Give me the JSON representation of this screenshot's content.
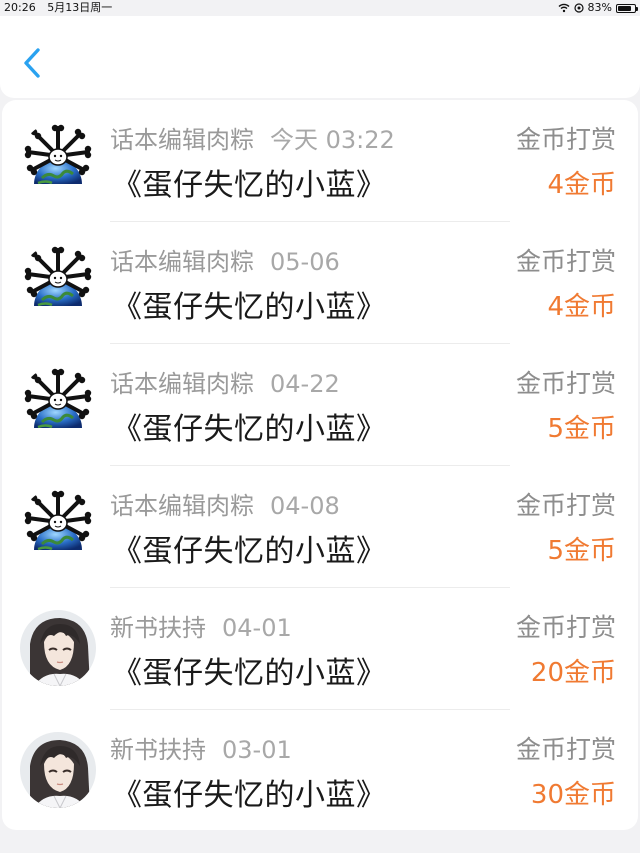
{
  "status_bar": {
    "time": "20:26",
    "date": "5月13日周一",
    "battery": "83%",
    "battery_level": 0.83
  },
  "nav": {
    "back_icon": "chevron-left-icon",
    "accent_color": "#2aa2f0"
  },
  "records": [
    {
      "user": "话本编辑肉粽",
      "date": "今天 03:22",
      "book": "《蛋仔失忆的小蓝》",
      "type": "金币打赏",
      "amount": "4金币",
      "avatar": "bones-globe"
    },
    {
      "user": "话本编辑肉粽",
      "date": "05-06",
      "book": "《蛋仔失忆的小蓝》",
      "type": "金币打赏",
      "amount": "4金币",
      "avatar": "bones-globe"
    },
    {
      "user": "话本编辑肉粽",
      "date": "04-22",
      "book": "《蛋仔失忆的小蓝》",
      "type": "金币打赏",
      "amount": "5金币",
      "avatar": "bones-globe"
    },
    {
      "user": "话本编辑肉粽",
      "date": "04-08",
      "book": "《蛋仔失忆的小蓝》",
      "type": "金币打赏",
      "amount": "5金币",
      "avatar": "bones-globe"
    },
    {
      "user": "新书扶持",
      "date": "04-01",
      "book": "《蛋仔失忆的小蓝》",
      "type": "金币打赏",
      "amount": "20金币",
      "avatar": "anime-character"
    },
    {
      "user": "新书扶持",
      "date": "03-01",
      "book": "《蛋仔失忆的小蓝》",
      "type": "金币打赏",
      "amount": "30金币",
      "avatar": "anime-character"
    }
  ],
  "colors": {
    "amount": "#f07a32",
    "meta": "#9a9a9a",
    "title": "#1a1a1a"
  }
}
